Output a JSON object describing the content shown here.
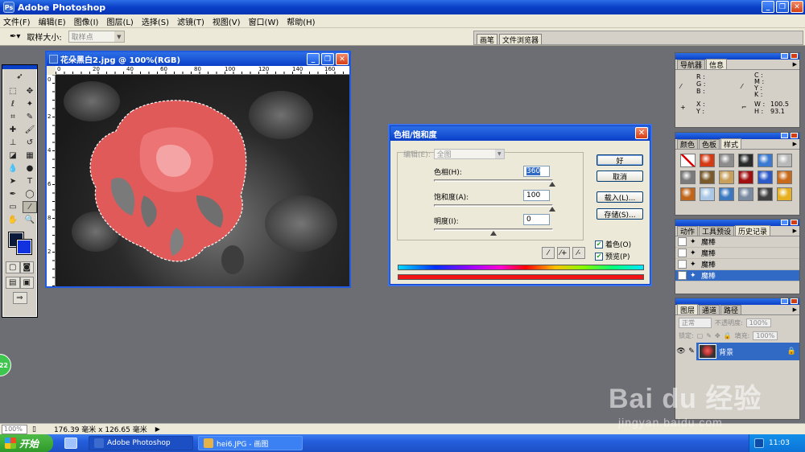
{
  "app": {
    "title": "Adobe Photoshop",
    "window_buttons": {
      "minimize": "_",
      "restore": "❐",
      "close": "✕"
    }
  },
  "menu": [
    "文件(F)",
    "编辑(E)",
    "图像(I)",
    "图层(L)",
    "选择(S)",
    "滤镜(T)",
    "视图(V)",
    "窗口(W)",
    "帮助(H)"
  ],
  "options": {
    "sample_label": "取样大小:",
    "sample_value": "取样点",
    "well_tabs": [
      "画笔",
      "文件浏览器"
    ]
  },
  "document": {
    "title": "花朵黑白2.jpg @ 100%(RGB)",
    "ruler_h": [
      "0",
      "20",
      "40",
      "60",
      "80",
      "100",
      "120",
      "140",
      "160"
    ],
    "ruler_v": [
      "0",
      "2",
      "4",
      "6",
      "8",
      "1",
      "1",
      "1",
      "1",
      "2"
    ]
  },
  "dialog": {
    "title": "色相/饱和度",
    "edit_label": "编辑(E):",
    "edit_value": "全图",
    "hue_label": "色相(H):",
    "hue_value": "360",
    "sat_label": "饱和度(A):",
    "sat_value": "100",
    "light_label": "明度(I):",
    "light_value": "0",
    "buttons": {
      "ok": "好",
      "cancel": "取消",
      "load": "载入(L)...",
      "save": "存储(S)..."
    },
    "colorize_label": "着色(O)",
    "colorize_checked": true,
    "preview_label": "预览(P)",
    "preview_checked": true,
    "hue_thumb": 1.0,
    "sat_thumb": 1.0,
    "light_thumb": 0.5
  },
  "navigator": {
    "tabs": [
      "导航器",
      "信息"
    ],
    "rgb_labels": [
      "R :",
      "G :",
      "B :"
    ],
    "cmyk_labels": [
      "C :",
      "M :",
      "Y :",
      "K :"
    ],
    "xy_labels": [
      "X :",
      "Y :"
    ],
    "w_label": "W :",
    "h_label": "H :",
    "w_value": "100.5",
    "h_value": "93.1"
  },
  "styles_panel": {
    "tabs": [
      "颜色",
      "色板",
      "样式"
    ],
    "swatches": [
      "#f5f5f5",
      "#d43b14",
      "#8c8c8c",
      "#2b2b2b",
      "#3a7ad0",
      "#b8b8b8",
      "#7a7a7a",
      "#7a5a2a",
      "#c8a05a",
      "#a01010",
      "#2c5ac8",
      "#c86a1a",
      "#c0661c",
      "#aac8e6",
      "#3c78c0",
      "#7a8aa0",
      "#404040",
      "#e6b020"
    ]
  },
  "history": {
    "tabs": [
      "动作",
      "工具预设",
      "历史记录"
    ],
    "items": [
      "魔棒",
      "魔棒",
      "魔棒",
      "魔棒"
    ]
  },
  "layers": {
    "tabs": [
      "图层",
      "通道",
      "路径"
    ],
    "blend": "正常",
    "opacity_label": "不透明度:",
    "opacity_value": "100%",
    "lock_label": "锁定:",
    "fill_label": "填充:",
    "fill_value": "100%",
    "layer_name": "背景"
  },
  "status": {
    "zoom": "100%",
    "doc_info": "176.39 毫米 x 126.65 毫米"
  },
  "taskbar": {
    "start": "开始",
    "tasks": [
      "Adobe Photoshop",
      "hei6.JPG - 画图"
    ],
    "clock": "11:03"
  },
  "badge_text": "22",
  "watermark": {
    "logo": "Bai du 经验",
    "url": "jingyan.baidu.com"
  },
  "colors": {
    "accent_blue": "#0a3fc8",
    "selected_row": "#316ac5",
    "foreground_color": "#0b1a3a",
    "background_color": "#1232e0"
  }
}
